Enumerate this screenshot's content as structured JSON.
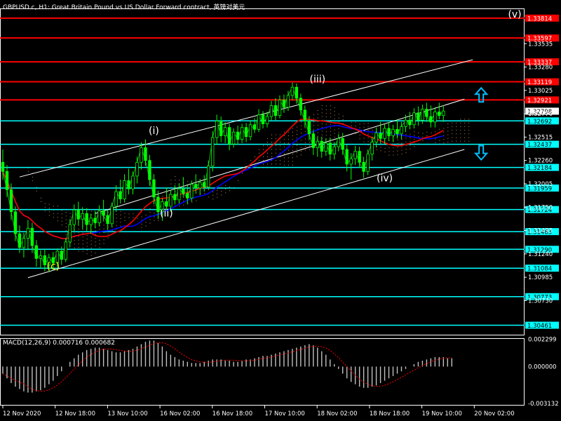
{
  "chart_title": "GBPUSD.c, H1:  Great Britain Pound vs US Dollar Forward contract, 英镑对美元",
  "macd_label": "MACD(12,26,9) 0.000716 0.000682",
  "colors": {
    "background": "#000000",
    "candles": "#00ff00",
    "resistance": "#ff0000",
    "support": "#00ffff",
    "ma_red": "#ff0000",
    "ma_blue": "#0000ff",
    "channel": "#ffffff",
    "ichimoku": "#f4a460",
    "macd_hist": "#c0c0c0",
    "macd_signal": "#ff0000",
    "arrow": "#00bfff"
  },
  "chart_data": [
    {
      "type": "candlestick",
      "title": "GBPUSD.c, H1:  Great Britain Pound vs US Dollar Forward contract, 英镑对美元",
      "x_ticks": [
        "12 Nov 2020",
        "12 Nov 18:00",
        "13 Nov 10:00",
        "16 Nov 02:00",
        "16 Nov 18:00",
        "17 Nov 10:00",
        "18 Nov 02:00",
        "18 Nov 18:00",
        "19 Nov 10:00",
        "20 Nov 02:00"
      ],
      "y_ticks": [
        "1.33535",
        "1.33280",
        "1.33025",
        "1.32770",
        "1.32515",
        "1.32260",
        "1.32005",
        "1.31750",
        "1.31495",
        "1.31240",
        "1.30985",
        "1.30730"
      ],
      "ylim": [
        1.3035,
        1.3392
      ],
      "current_price": "1.32798",
      "resistance_levels": [
        {
          "label": "1.33814",
          "value": 1.33814
        },
        {
          "label": "1.33597",
          "value": 1.33597
        },
        {
          "label": "1.33337",
          "value": 1.33337
        },
        {
          "label": "1.33119",
          "value": 1.33119
        },
        {
          "label": "1.32921",
          "value": 1.32921
        }
      ],
      "support_levels": [
        {
          "label": "1.32692",
          "value": 1.32692
        },
        {
          "label": "1.32437",
          "value": 1.32437
        },
        {
          "label": "1.32184",
          "value": 1.32184
        },
        {
          "label": "1.31959",
          "value": 1.31959
        },
        {
          "label": "1.31724",
          "value": 1.31724
        },
        {
          "label": "1.31483",
          "value": 1.31483
        },
        {
          "label": "1.31290",
          "value": 1.3129
        },
        {
          "label": "1.31084",
          "value": 1.31084
        },
        {
          "label": "1.30773",
          "value": 1.30773
        },
        {
          "label": "1.30461",
          "value": 1.30461
        }
      ],
      "wave_labels": [
        {
          "text": "(c)",
          "bar": 12,
          "price": 1.3107
        },
        {
          "text": "(i)",
          "bar": 36,
          "price": 1.3255
        },
        {
          "text": "(ii)",
          "bar": 39,
          "price": 1.3165
        },
        {
          "text": "(iii)",
          "bar": 75,
          "price": 1.3311
        },
        {
          "text": "(iv)",
          "bar": 91,
          "price": 1.3203
        },
        {
          "text": "(v)",
          "bar": 122,
          "price": 1.3382
        }
      ],
      "channel": {
        "upper": [
          [
            4,
            1.3208
          ],
          [
            112,
            1.3336
          ]
        ],
        "lower": [
          [
            6,
            1.3098
          ],
          [
            110,
            1.3238
          ]
        ],
        "middle": [
          [
            22,
            1.3168
          ],
          [
            110,
            1.3293
          ]
        ]
      },
      "arrows": [
        {
          "direction": "up",
          "bar": 114,
          "price": 1.3296
        },
        {
          "direction": "down",
          "bar": 114,
          "price": 1.3236
        }
      ],
      "bar_count": 108,
      "candles": [
        {
          "o": 1.3224,
          "h": 1.3238,
          "l": 1.3205,
          "c": 1.3214
        },
        {
          "o": 1.3214,
          "h": 1.3221,
          "l": 1.3186,
          "c": 1.3194
        },
        {
          "o": 1.3194,
          "h": 1.3201,
          "l": 1.3161,
          "c": 1.317
        },
        {
          "o": 1.317,
          "h": 1.3176,
          "l": 1.3138,
          "c": 1.3146
        },
        {
          "o": 1.3146,
          "h": 1.3155,
          "l": 1.3125,
          "c": 1.3131
        },
        {
          "o": 1.3131,
          "h": 1.3147,
          "l": 1.312,
          "c": 1.3141
        },
        {
          "o": 1.3141,
          "h": 1.3161,
          "l": 1.3128,
          "c": 1.3152
        },
        {
          "o": 1.3152,
          "h": 1.3158,
          "l": 1.3125,
          "c": 1.3133
        },
        {
          "o": 1.3133,
          "h": 1.3139,
          "l": 1.311,
          "c": 1.3119
        },
        {
          "o": 1.3119,
          "h": 1.3128,
          "l": 1.3108,
          "c": 1.3122
        },
        {
          "o": 1.3122,
          "h": 1.3129,
          "l": 1.3105,
          "c": 1.3112
        },
        {
          "o": 1.3112,
          "h": 1.3124,
          "l": 1.3104,
          "c": 1.312
        },
        {
          "o": 1.312,
          "h": 1.3126,
          "l": 1.3106,
          "c": 1.3114
        },
        {
          "o": 1.3114,
          "h": 1.313,
          "l": 1.311,
          "c": 1.3127
        },
        {
          "o": 1.3127,
          "h": 1.3132,
          "l": 1.3112,
          "c": 1.3118
        },
        {
          "o": 1.3118,
          "h": 1.3141,
          "l": 1.3115,
          "c": 1.3137
        },
        {
          "o": 1.3137,
          "h": 1.3162,
          "l": 1.3131,
          "c": 1.3156
        },
        {
          "o": 1.3156,
          "h": 1.3178,
          "l": 1.3148,
          "c": 1.3172
        },
        {
          "o": 1.3172,
          "h": 1.3181,
          "l": 1.3155,
          "c": 1.3162
        },
        {
          "o": 1.3162,
          "h": 1.3175,
          "l": 1.3151,
          "c": 1.3168
        },
        {
          "o": 1.3168,
          "h": 1.3174,
          "l": 1.3149,
          "c": 1.3156
        },
        {
          "o": 1.3156,
          "h": 1.3168,
          "l": 1.3146,
          "c": 1.3163
        },
        {
          "o": 1.3163,
          "h": 1.3171,
          "l": 1.3152,
          "c": 1.3158
        },
        {
          "o": 1.3158,
          "h": 1.3177,
          "l": 1.3154,
          "c": 1.3171
        },
        {
          "o": 1.3171,
          "h": 1.3183,
          "l": 1.316,
          "c": 1.3166
        },
        {
          "o": 1.3166,
          "h": 1.3172,
          "l": 1.315,
          "c": 1.3157
        },
        {
          "o": 1.3157,
          "h": 1.318,
          "l": 1.3153,
          "c": 1.3176
        },
        {
          "o": 1.3176,
          "h": 1.3199,
          "l": 1.317,
          "c": 1.3192
        },
        {
          "o": 1.3192,
          "h": 1.3205,
          "l": 1.3179,
          "c": 1.3184
        },
        {
          "o": 1.3184,
          "h": 1.3211,
          "l": 1.318,
          "c": 1.3204
        },
        {
          "o": 1.3204,
          "h": 1.3217,
          "l": 1.3189,
          "c": 1.3195
        },
        {
          "o": 1.3195,
          "h": 1.3214,
          "l": 1.3189,
          "c": 1.3209
        },
        {
          "o": 1.3209,
          "h": 1.323,
          "l": 1.3201,
          "c": 1.3224
        },
        {
          "o": 1.3224,
          "h": 1.3246,
          "l": 1.3216,
          "c": 1.324
        },
        {
          "o": 1.324,
          "h": 1.3249,
          "l": 1.322,
          "c": 1.3226
        },
        {
          "o": 1.3226,
          "h": 1.3232,
          "l": 1.3198,
          "c": 1.3205
        },
        {
          "o": 1.3205,
          "h": 1.3211,
          "l": 1.3178,
          "c": 1.3186
        },
        {
          "o": 1.3186,
          "h": 1.3193,
          "l": 1.3162,
          "c": 1.317
        },
        {
          "o": 1.317,
          "h": 1.3185,
          "l": 1.316,
          "c": 1.3181
        },
        {
          "o": 1.3181,
          "h": 1.3196,
          "l": 1.3172,
          "c": 1.3176
        },
        {
          "o": 1.3176,
          "h": 1.3194,
          "l": 1.317,
          "c": 1.3189
        },
        {
          "o": 1.3189,
          "h": 1.3199,
          "l": 1.3178,
          "c": 1.3183
        },
        {
          "o": 1.3183,
          "h": 1.3201,
          "l": 1.3179,
          "c": 1.3195
        },
        {
          "o": 1.3195,
          "h": 1.3208,
          "l": 1.3186,
          "c": 1.319
        },
        {
          "o": 1.319,
          "h": 1.3199,
          "l": 1.3178,
          "c": 1.3185
        },
        {
          "o": 1.3185,
          "h": 1.3204,
          "l": 1.3181,
          "c": 1.32
        },
        {
          "o": 1.32,
          "h": 1.3211,
          "l": 1.319,
          "c": 1.3196
        },
        {
          "o": 1.3196,
          "h": 1.3206,
          "l": 1.3188,
          "c": 1.3202
        },
        {
          "o": 1.3202,
          "h": 1.321,
          "l": 1.3192,
          "c": 1.3197
        },
        {
          "o": 1.3197,
          "h": 1.3226,
          "l": 1.3194,
          "c": 1.322
        },
        {
          "o": 1.322,
          "h": 1.3258,
          "l": 1.3214,
          "c": 1.3251
        },
        {
          "o": 1.3251,
          "h": 1.3276,
          "l": 1.3243,
          "c": 1.3269
        },
        {
          "o": 1.3269,
          "h": 1.3274,
          "l": 1.3246,
          "c": 1.3253
        },
        {
          "o": 1.3253,
          "h": 1.3268,
          "l": 1.3245,
          "c": 1.3262
        },
        {
          "o": 1.3262,
          "h": 1.3266,
          "l": 1.3237,
          "c": 1.3244
        },
        {
          "o": 1.3244,
          "h": 1.3261,
          "l": 1.324,
          "c": 1.3257
        },
        {
          "o": 1.3257,
          "h": 1.3264,
          "l": 1.3243,
          "c": 1.3249
        },
        {
          "o": 1.3249,
          "h": 1.3266,
          "l": 1.3245,
          "c": 1.3262
        },
        {
          "o": 1.3262,
          "h": 1.3267,
          "l": 1.3246,
          "c": 1.3252
        },
        {
          "o": 1.3252,
          "h": 1.327,
          "l": 1.3248,
          "c": 1.3265
        },
        {
          "o": 1.3265,
          "h": 1.3272,
          "l": 1.3256,
          "c": 1.326
        },
        {
          "o": 1.326,
          "h": 1.3282,
          "l": 1.3257,
          "c": 1.3276
        },
        {
          "o": 1.3276,
          "h": 1.328,
          "l": 1.3261,
          "c": 1.3266
        },
        {
          "o": 1.3266,
          "h": 1.3279,
          "l": 1.3262,
          "c": 1.3274
        },
        {
          "o": 1.3274,
          "h": 1.3291,
          "l": 1.327,
          "c": 1.3286
        },
        {
          "o": 1.3286,
          "h": 1.3294,
          "l": 1.327,
          "c": 1.3275
        },
        {
          "o": 1.3275,
          "h": 1.3297,
          "l": 1.3272,
          "c": 1.3292
        },
        {
          "o": 1.3292,
          "h": 1.3298,
          "l": 1.3278,
          "c": 1.3284
        },
        {
          "o": 1.3284,
          "h": 1.3302,
          "l": 1.328,
          "c": 1.3297
        },
        {
          "o": 1.3297,
          "h": 1.3311,
          "l": 1.3292,
          "c": 1.3306
        },
        {
          "o": 1.3306,
          "h": 1.331,
          "l": 1.3288,
          "c": 1.3294
        },
        {
          "o": 1.3294,
          "h": 1.3299,
          "l": 1.3275,
          "c": 1.3281
        },
        {
          "o": 1.3281,
          "h": 1.3286,
          "l": 1.3262,
          "c": 1.3269
        },
        {
          "o": 1.3269,
          "h": 1.3274,
          "l": 1.3248,
          "c": 1.3255
        },
        {
          "o": 1.3255,
          "h": 1.3259,
          "l": 1.3232,
          "c": 1.324
        },
        {
          "o": 1.324,
          "h": 1.3252,
          "l": 1.323,
          "c": 1.3247
        },
        {
          "o": 1.3247,
          "h": 1.3252,
          "l": 1.3229,
          "c": 1.3236
        },
        {
          "o": 1.3236,
          "h": 1.325,
          "l": 1.3231,
          "c": 1.3245
        },
        {
          "o": 1.3245,
          "h": 1.3251,
          "l": 1.3226,
          "c": 1.3233
        },
        {
          "o": 1.3233,
          "h": 1.3246,
          "l": 1.3227,
          "c": 1.3241
        },
        {
          "o": 1.3241,
          "h": 1.3255,
          "l": 1.3236,
          "c": 1.325
        },
        {
          "o": 1.325,
          "h": 1.3256,
          "l": 1.3232,
          "c": 1.3238
        },
        {
          "o": 1.3238,
          "h": 1.3243,
          "l": 1.3214,
          "c": 1.3222
        },
        {
          "o": 1.3222,
          "h": 1.3234,
          "l": 1.3205,
          "c": 1.3228
        },
        {
          "o": 1.3228,
          "h": 1.3242,
          "l": 1.3221,
          "c": 1.3236
        },
        {
          "o": 1.3236,
          "h": 1.3241,
          "l": 1.3218,
          "c": 1.3224
        },
        {
          "o": 1.3224,
          "h": 1.323,
          "l": 1.3207,
          "c": 1.3214
        },
        {
          "o": 1.3214,
          "h": 1.3238,
          "l": 1.321,
          "c": 1.3233
        },
        {
          "o": 1.3233,
          "h": 1.3252,
          "l": 1.3226,
          "c": 1.3246
        },
        {
          "o": 1.3246,
          "h": 1.3262,
          "l": 1.324,
          "c": 1.3256
        },
        {
          "o": 1.3256,
          "h": 1.3268,
          "l": 1.3245,
          "c": 1.325
        },
        {
          "o": 1.325,
          "h": 1.3266,
          "l": 1.3244,
          "c": 1.3261
        },
        {
          "o": 1.3261,
          "h": 1.3268,
          "l": 1.3247,
          "c": 1.3253
        },
        {
          "o": 1.3253,
          "h": 1.3265,
          "l": 1.3246,
          "c": 1.326
        },
        {
          "o": 1.326,
          "h": 1.3271,
          "l": 1.325,
          "c": 1.3255
        },
        {
          "o": 1.3255,
          "h": 1.3268,
          "l": 1.3249,
          "c": 1.3263
        },
        {
          "o": 1.3263,
          "h": 1.3276,
          "l": 1.3257,
          "c": 1.327
        },
        {
          "o": 1.327,
          "h": 1.3279,
          "l": 1.326,
          "c": 1.3265
        },
        {
          "o": 1.3265,
          "h": 1.3283,
          "l": 1.3261,
          "c": 1.3278
        },
        {
          "o": 1.3278,
          "h": 1.3285,
          "l": 1.3264,
          "c": 1.327
        },
        {
          "o": 1.327,
          "h": 1.3287,
          "l": 1.3266,
          "c": 1.3282
        },
        {
          "o": 1.3282,
          "h": 1.3289,
          "l": 1.3268,
          "c": 1.3274
        },
        {
          "o": 1.3274,
          "h": 1.3286,
          "l": 1.3262,
          "c": 1.3268
        },
        {
          "o": 1.3268,
          "h": 1.3284,
          "l": 1.3262,
          "c": 1.3279
        },
        {
          "o": 1.3279,
          "h": 1.3289,
          "l": 1.3271,
          "c": 1.3275
        },
        {
          "o": 1.3275,
          "h": 1.3286,
          "l": 1.3268,
          "c": 1.328
        }
      ]
    },
    {
      "type": "bar",
      "title": "MACD(12,26,9) 0.000716 0.000682",
      "y_ticks": [
        "0.002299",
        "0.000000",
        "-0.003132"
      ],
      "ylim": [
        -0.0033,
        0.0024
      ],
      "histogram_values": [
        -0.0006,
        -0.001,
        -0.0014,
        -0.0017,
        -0.0019,
        -0.0021,
        -0.0022,
        -0.0022,
        -0.0021,
        -0.002,
        -0.0018,
        -0.0015,
        -0.0012,
        -0.0008,
        -0.0004,
        0.0,
        0.0004,
        0.0007,
        0.001,
        0.0012,
        0.0014,
        0.0015,
        0.0016,
        0.0016,
        0.0015,
        0.0014,
        0.0013,
        0.0012,
        0.0012,
        0.0013,
        0.0014,
        0.0015,
        0.0017,
        0.0019,
        0.0021,
        0.0022,
        0.0022,
        0.002,
        0.0017,
        0.0013,
        0.001,
        0.0008,
        0.0006,
        0.0005,
        0.0004,
        0.0003,
        0.0003,
        0.0003,
        0.0004,
        0.0005,
        0.0006,
        0.0006,
        0.0006,
        0.0005,
        0.0005,
        0.0004,
        0.0004,
        0.0005,
        0.0006,
        0.0006,
        0.0007,
        0.0008,
        0.0009,
        0.0009,
        0.001,
        0.0011,
        0.0012,
        0.0013,
        0.0014,
        0.0015,
        0.0016,
        0.0017,
        0.0018,
        0.0019,
        0.0018,
        0.0016,
        0.0013,
        0.001,
        0.0006,
        0.0002,
        -0.0002,
        -0.0006,
        -0.001,
        -0.0013,
        -0.0015,
        -0.0017,
        -0.0018,
        -0.0018,
        -0.0017,
        -0.0016,
        -0.0014,
        -0.0012,
        -0.001,
        -0.0008,
        -0.0006,
        -0.0004,
        -0.0002,
        0.0,
        0.0002,
        0.0004,
        0.0005,
        0.0006,
        0.0007,
        0.0008,
        0.0008,
        0.0008,
        0.0007,
        0.0007
      ]
    }
  ]
}
